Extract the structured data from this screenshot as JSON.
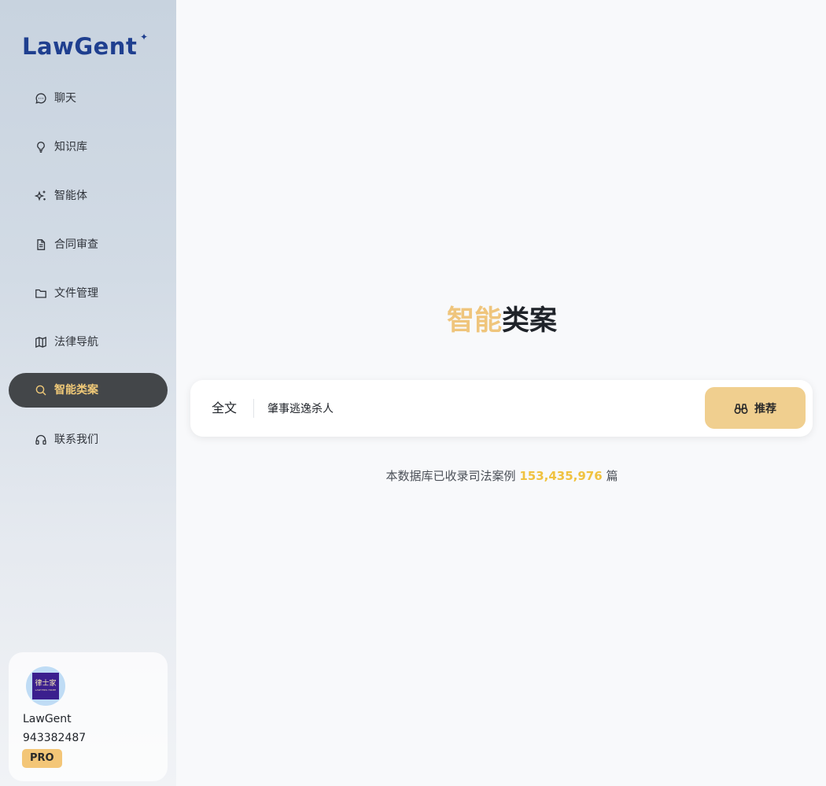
{
  "app": {
    "logo": "LawGent"
  },
  "nav": {
    "items": [
      {
        "label": "聊天",
        "icon": "chat-bubble-icon"
      },
      {
        "label": "知识库",
        "icon": "lightbulb-icon"
      },
      {
        "label": "智能体",
        "icon": "sparkle-icon"
      },
      {
        "label": "合同审查",
        "icon": "document-icon"
      },
      {
        "label": "文件管理",
        "icon": "folder-icon"
      },
      {
        "label": "法律导航",
        "icon": "map-icon"
      },
      {
        "label": "智能类案",
        "icon": "search-icon",
        "active": true
      },
      {
        "label": "联系我们",
        "icon": "headset-icon"
      }
    ]
  },
  "profile": {
    "avatar_text": "律士家",
    "avatar_subtext": "LAWYERS HOME",
    "name": "LawGent",
    "id": "943382487",
    "badge": "PRO"
  },
  "main": {
    "title_highlight": "智能",
    "title_rest": "类案",
    "search": {
      "scope": "全文",
      "query": "肇事逃逸杀人",
      "button_label": "推荐",
      "button_icon": "binoculars-icon"
    },
    "stats": {
      "prefix": "本数据库已收录司法案例",
      "count": "153,435,976",
      "suffix": "篇"
    }
  },
  "colors": {
    "accent": "#efc57c",
    "active_nav_bg": "#434649",
    "count_color": "#f0c240",
    "logo": "#1f3f8f"
  }
}
